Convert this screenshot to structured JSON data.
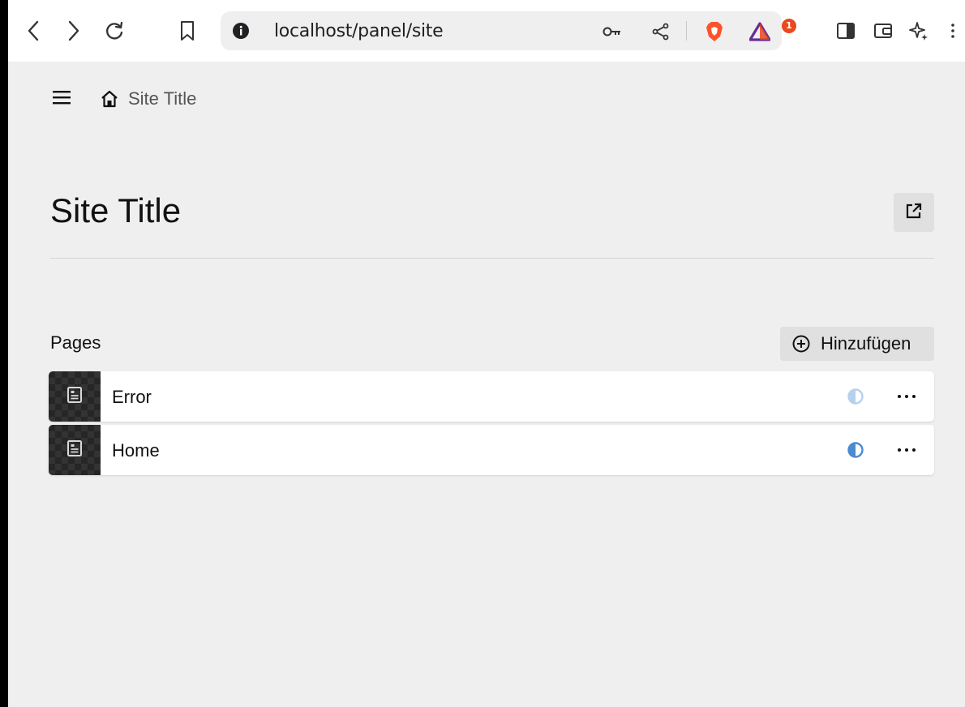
{
  "browser": {
    "url": "localhost/panel/site",
    "rewards_badge": "1",
    "icons": [
      "back-icon",
      "forward-icon",
      "reload-icon",
      "bookmark-icon",
      "info-icon",
      "key-icon",
      "share-icon",
      "brave-shield-icon",
      "brave-rewards-icon",
      "sidebar-icon",
      "wallet-icon",
      "leo-ai-icon",
      "menu-icon"
    ]
  },
  "breadcrumb": {
    "home_label": "Site Title"
  },
  "page": {
    "title": "Site Title"
  },
  "pages_section": {
    "label": "Pages",
    "add_label": "Hinzufügen",
    "items": [
      {
        "label": "Error",
        "status": "unlisted",
        "status_color": "#b7d0ee"
      },
      {
        "label": "Home",
        "status": "unlisted",
        "status_color": "#4a8bd1"
      }
    ]
  },
  "colors": {
    "background": "#efefef",
    "accent": "#4a8bd1",
    "brave_orange": "#fb542b"
  }
}
